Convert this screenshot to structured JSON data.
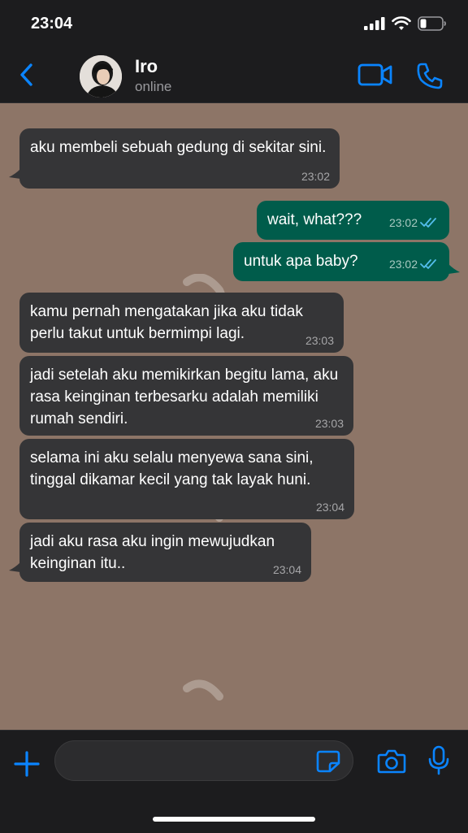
{
  "status": {
    "time": "23:04"
  },
  "header": {
    "contact_name": "Iro",
    "contact_status": "online"
  },
  "messages": [
    {
      "direction": "in",
      "text": "aku membeli sebuah gedung di sekitar sini.",
      "time": "23:02"
    },
    {
      "direction": "out",
      "text": "wait, what???",
      "time": "23:02",
      "read": true
    },
    {
      "direction": "out",
      "text": "untuk apa baby?",
      "time": "23:02",
      "read": true
    },
    {
      "direction": "in",
      "text": "kamu pernah mengatakan jika aku tidak perlu takut untuk bermimpi lagi.",
      "time": "23:03"
    },
    {
      "direction": "in",
      "text": "jadi setelah aku memikirkan begitu lama, aku rasa keinginan terbesarku adalah memiliki rumah sendiri.",
      "time": "23:03"
    },
    {
      "direction": "in",
      "text": "selama ini aku selalu menyewa sana sini, tinggal dikamar kecil yang tak layak huni.",
      "time": "23:04"
    },
    {
      "direction": "in",
      "text": "jadi aku rasa aku ingin mewujudkan keinginan itu..",
      "time": "23:04"
    }
  ],
  "input": {
    "value": "",
    "placeholder": ""
  },
  "icons": {
    "back": "chevron-left-icon",
    "video": "video-camera-icon",
    "call": "phone-icon",
    "plus": "plus-icon",
    "sticker": "sticker-icon",
    "camera": "camera-icon",
    "mic": "microphone-icon",
    "read_receipt": "double-check-icon"
  },
  "colors": {
    "accent": "#0a84ff",
    "chat_background": "#8d7567",
    "incoming_bubble": "#353537",
    "outgoing_bubble": "#005c4b",
    "read_check": "#53bdeb"
  }
}
